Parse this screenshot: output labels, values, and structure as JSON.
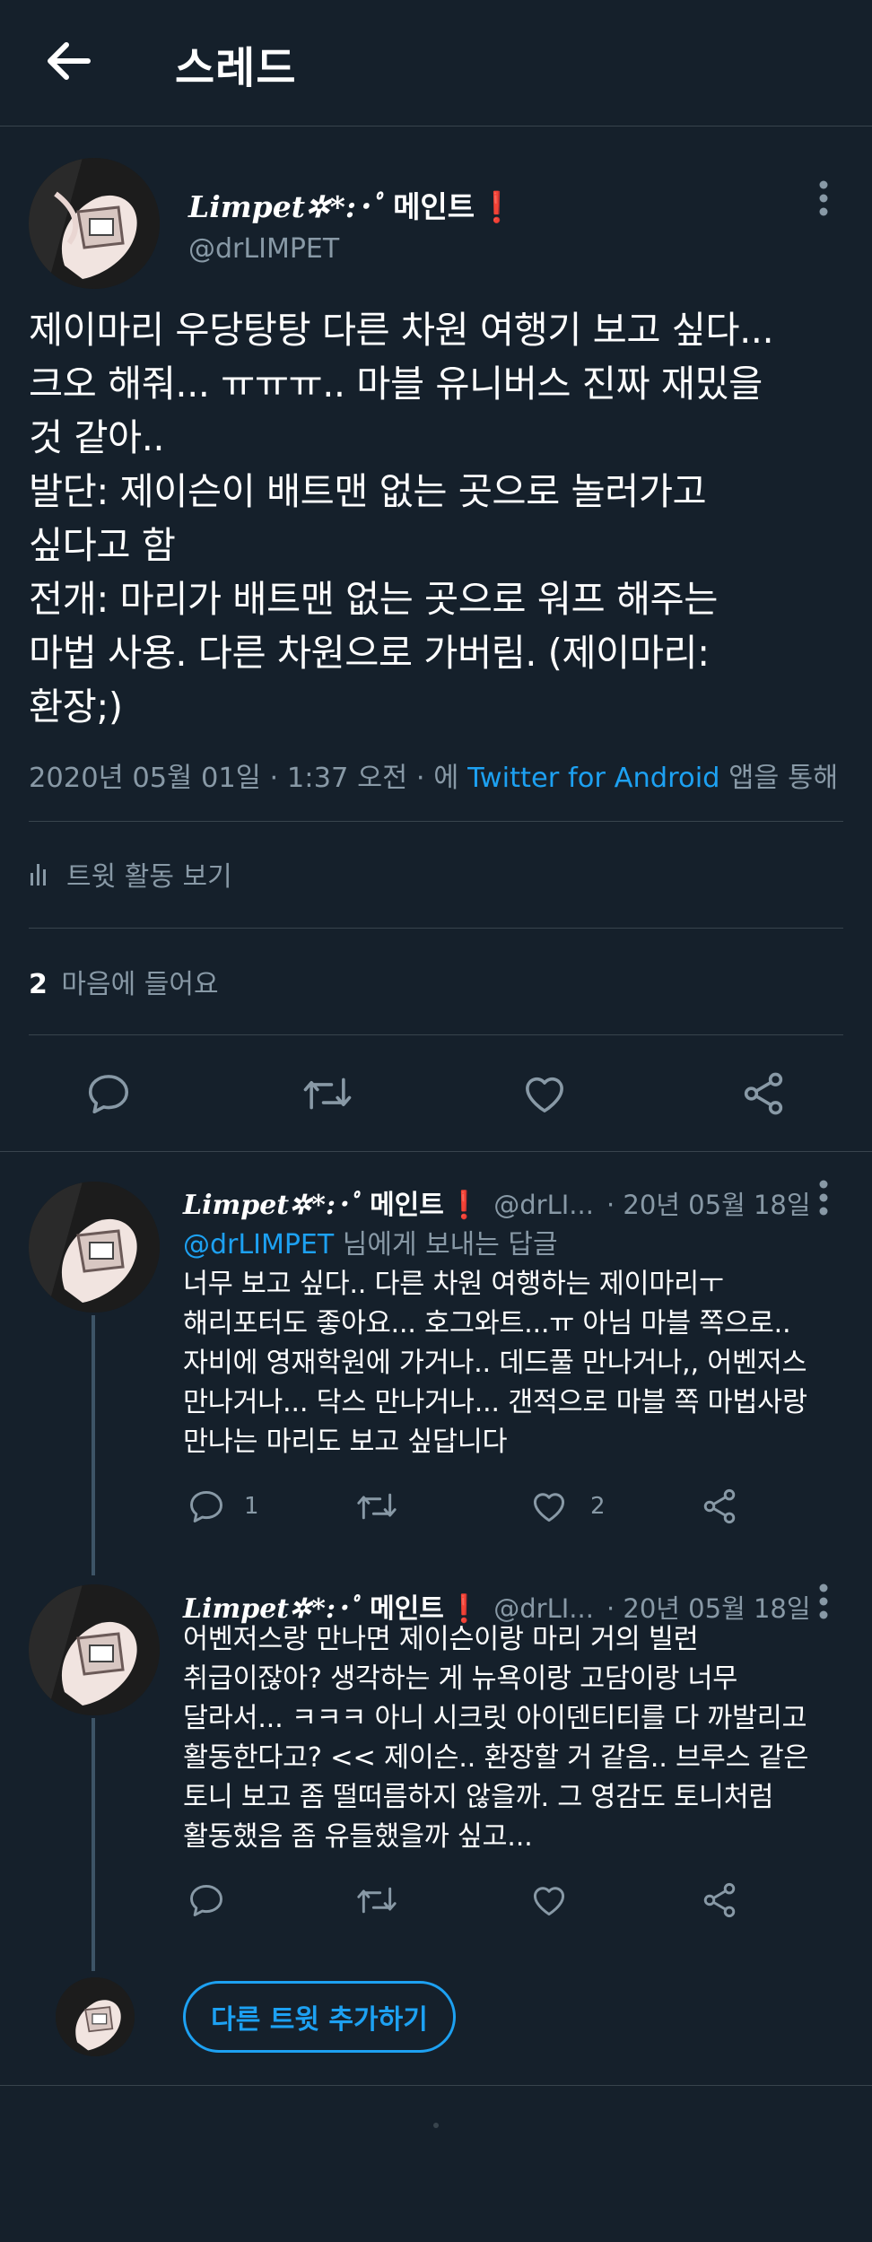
{
  "header": {
    "title": "스레드"
  },
  "main_tweet": {
    "display_name_deco": "Limpet✲*:･ﾟ",
    "display_name_kr": "메인트",
    "display_name_mark": "❗",
    "handle": "@drLIMPET",
    "lines": [
      "제이마리 우당탕탕 다른 차원 여행기 보고 싶다...",
      "크오 해줘... ㅠㅠㅠ.. 마블 유니버스 진짜 재밌을",
      "것 같아..",
      "발단: 제이슨이 배트맨 없는 곳으로 놀러가고",
      "싶다고 함",
      "전개: 마리가 배트맨 없는 곳으로 워프 해주는",
      "마법 사용. 다른 차원으로 가버림. (제이마리:",
      "환장;)"
    ],
    "timestamp": "2020년 05월 01일 · 1:37 오전 · 에",
    "client": "Twitter for Android",
    "client_suffix": "앱을 통해",
    "activity_label": "트윗 활동 보기",
    "likes_count": "2",
    "likes_label": "마음에 들어요"
  },
  "replies": [
    {
      "display_name_deco": "Limpet✲*:･ﾟ",
      "display_name_kr": "메인트",
      "display_name_mark": "❗",
      "handle": "@drLI...",
      "date": "· 20년 05월 18일",
      "reply_to_handle": "@drLIMPET",
      "reply_to_suffix": "님에게 보내는 답글",
      "lines": [
        "너무 보고 싶다.. 다른 차원 여행하는 제이마리ㅜ",
        "해리포터도 좋아요... 호그와트...ㅠ 아님 마블 쪽으로..",
        "자비에 영재학원에 가거나.. 데드풀 만나거나,, 어벤저스",
        "만나거나... 닥스 만나거나... 갠적으로 마블 쪽 마법사랑",
        "만나는 마리도 보고 싶답니다"
      ],
      "reply_count": "1",
      "like_count": "2"
    },
    {
      "display_name_deco": "Limpet✲*:･ﾟ",
      "display_name_kr": "메인트",
      "display_name_mark": "❗",
      "handle": "@drLI...",
      "date": "· 20년 05월 18일",
      "lines": [
        "어벤저스랑 만나면 제이슨이랑 마리 거의 빌런",
        "취급이잖아? 생각하는 게 뉴욕이랑 고담이랑 너무",
        "달라서... ㅋㅋㅋ 아니 시크릿 아이덴티티를 다 까발리고",
        "활동한다고? << 제이슨.. 환장할 거 같음.. 브루스 같은",
        "토니 보고 좀 떨떠름하지 않을까. 그 영감도 토니처럼",
        "활동했음 좀 유들했을까 싶고..."
      ]
    }
  ],
  "add_tweet_label": "다른 트윗 추가하기",
  "colors": {
    "background": "#15202b",
    "accent": "#1da1f2",
    "muted": "#8899a6",
    "divider": "#38444d",
    "warning": "#e0245e"
  }
}
